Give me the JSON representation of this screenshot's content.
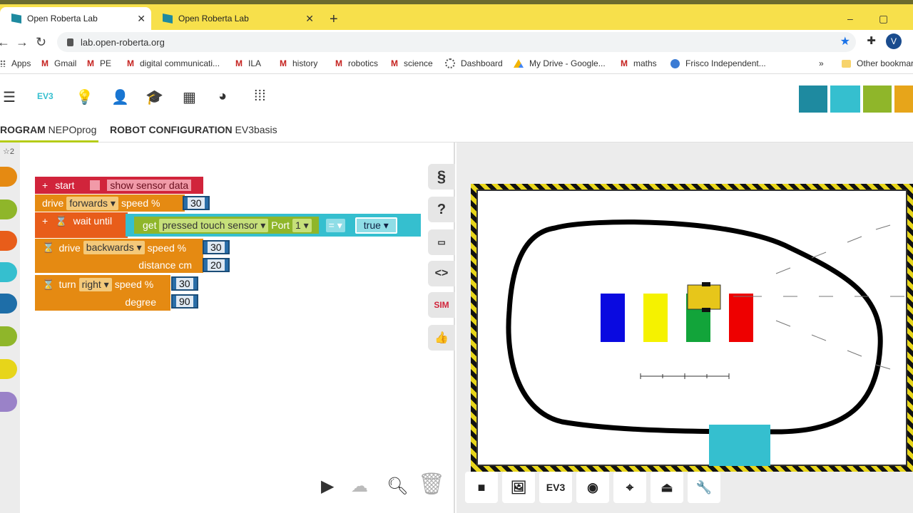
{
  "browser": {
    "tabs": [
      {
        "title": "Open Roberta Lab",
        "active": true
      },
      {
        "title": "Open Roberta Lab",
        "active": false
      }
    ],
    "url": "lab.open-roberta.org",
    "avatar_letter": "V",
    "window_controls": [
      "–",
      "▢",
      "✕"
    ]
  },
  "bookmarks": [
    {
      "label": "Apps",
      "icon": "apps-grid-icon"
    },
    {
      "label": "Gmail",
      "icon": "gmail-icon"
    },
    {
      "label": "PE",
      "icon": "gmail-icon"
    },
    {
      "label": "digital communicati...",
      "icon": "gmail-icon"
    },
    {
      "label": "ILA",
      "icon": "gmail-icon"
    },
    {
      "label": "history",
      "icon": "gmail-icon"
    },
    {
      "label": "robotics",
      "icon": "gmail-icon"
    },
    {
      "label": "science",
      "icon": "gmail-icon"
    },
    {
      "label": "Dashboard",
      "icon": "dashboard-icon"
    },
    {
      "label": "My Drive - Google...",
      "icon": "google-drive-icon"
    },
    {
      "label": "maths",
      "icon": "gmail-icon"
    },
    {
      "label": "Frisco Independent...",
      "icon": "school-icon"
    },
    {
      "label": "»",
      "icon": "more-icon"
    },
    {
      "label": "Other bookmarks",
      "icon": "folder-icon"
    }
  ],
  "app_toolbar": {
    "ev3_label": "EV3"
  },
  "program_tabs": {
    "program_prefix": "ROGRAM",
    "program_name": "NEPOprog",
    "config_prefix": "ROBOT CONFIGURATION",
    "config_name": "EV3basis"
  },
  "toolbox_badge": "☆2",
  "blocks": {
    "start": "start",
    "show_sensor": "show sensor data",
    "drive1_label": "drive",
    "drive1_dir": "forwards",
    "drive1_speed_label": "speed %",
    "drive1_speed": "30",
    "wait_label": "wait until",
    "get_label": "get",
    "sensor_mode": "pressed",
    "sensor_name": "touch sensor",
    "port_label": "Port",
    "port_value": "1",
    "compare_op": "=",
    "compare_value": "true",
    "drive2_label": "drive",
    "drive2_dir": "backwards",
    "drive2_speed_label": "speed %",
    "drive2_speed": "30",
    "drive2_dist_label": "distance cm",
    "drive2_dist": "20",
    "turn_label": "turn",
    "turn_dir": "right",
    "turn_speed_label": "speed %",
    "turn_speed": "30",
    "turn_deg_label": "degree",
    "turn_deg": "90"
  },
  "side_buttons": {
    "sim_label": "SIM"
  },
  "sim_toolbar": {
    "ev3_label": "EV3"
  },
  "colors": {
    "accent": "#b5cc18",
    "start_block": "#d1243b",
    "motion_block": "#e58a12",
    "sensor_block": "#8fb62a",
    "logic_block": "#35bfcf",
    "hazard": "#e7d51a"
  }
}
